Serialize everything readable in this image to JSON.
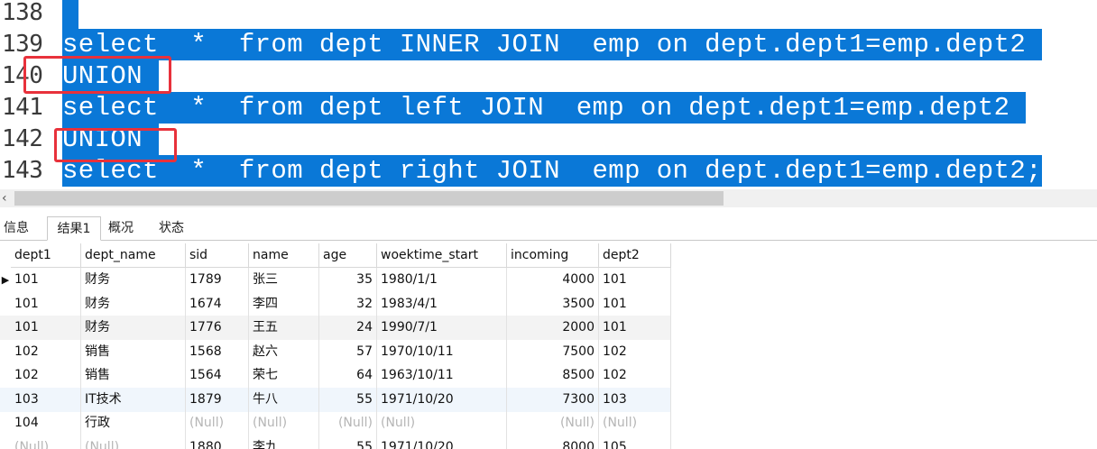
{
  "editor": {
    "lines": [
      {
        "num": "138",
        "code": ""
      },
      {
        "num": "139",
        "code": "select  *  from dept INNER JOIN  emp on dept.dept1=emp.dept2 "
      },
      {
        "num": "140",
        "code": "UNION "
      },
      {
        "num": "141",
        "code": "select  *  from dept left JOIN  emp on dept.dept1=emp.dept2 "
      },
      {
        "num": "142",
        "code": "UNION "
      },
      {
        "num": "143",
        "code": "select  *  from dept right JOIN  emp on dept.dept1=emp.dept2;"
      }
    ]
  },
  "tabs": [
    "信息",
    "结果1",
    "概况",
    "状态"
  ],
  "active_tab": "结果1",
  "grid": {
    "columns": [
      "dept1",
      "dept_name",
      "sid",
      "name",
      "age",
      "woektime_start",
      "incoming",
      "dept2"
    ],
    "rows": [
      [
        "101",
        "财务",
        "1789",
        "张三",
        "35",
        "1980/1/1",
        "4000",
        "101"
      ],
      [
        "101",
        "财务",
        "1674",
        "李四",
        "32",
        "1983/4/1",
        "3500",
        "101"
      ],
      [
        "101",
        "财务",
        "1776",
        "王五",
        "24",
        "1990/7/1",
        "2000",
        "101"
      ],
      [
        "102",
        "销售",
        "1568",
        "赵六",
        "57",
        "1970/10/11",
        "7500",
        "102"
      ],
      [
        "102",
        "销售",
        "1564",
        "荣七",
        "64",
        "1963/10/11",
        "8500",
        "102"
      ],
      [
        "103",
        "IT技术",
        "1879",
        "牛八",
        "55",
        "1971/10/20",
        "7300",
        "103"
      ],
      [
        "104",
        "行政",
        "(Null)",
        "(Null)",
        "(Null)",
        "(Null)",
        "(Null)",
        "(Null)"
      ],
      [
        "(Null)",
        "(Null)",
        "1880",
        "李九",
        "55",
        "1971/10/20",
        "8000",
        "105"
      ]
    ]
  },
  "colors": {
    "selection": "#0a78d7",
    "annotation": "#e8313b",
    "null_text": "#b5b5b5"
  }
}
